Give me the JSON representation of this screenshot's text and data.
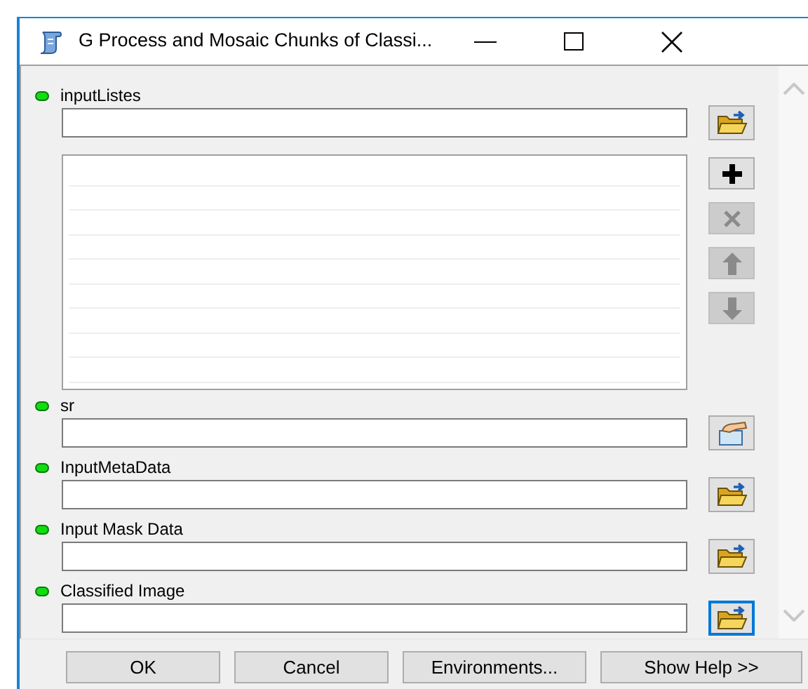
{
  "window": {
    "title": "G Process and Mosaic Chunks of Classi..."
  },
  "parameters": [
    {
      "label": "inputListes",
      "required": true,
      "kind": "list",
      "browse_button": {
        "kind": "folder",
        "focused": false
      }
    },
    {
      "label": "sr",
      "required": true,
      "kind": "field",
      "browse_button": {
        "kind": "spatial",
        "focused": false
      }
    },
    {
      "label": "InputMetaData",
      "required": true,
      "kind": "field",
      "browse_button": {
        "kind": "folder",
        "focused": false
      }
    },
    {
      "label": "Input Mask Data",
      "required": true,
      "kind": "field",
      "browse_button": {
        "kind": "folder",
        "focused": false
      }
    },
    {
      "label": "Classified Image",
      "required": true,
      "kind": "field",
      "browse_button": {
        "kind": "folder",
        "focused": true
      }
    }
  ],
  "list_tools": [
    {
      "kind": "add",
      "disabled": false
    },
    {
      "kind": "remove",
      "disabled": true
    },
    {
      "kind": "up",
      "disabled": true
    },
    {
      "kind": "down",
      "disabled": true
    }
  ],
  "buttons": [
    "OK",
    "Cancel",
    "Environments...",
    "Show Help >>"
  ]
}
